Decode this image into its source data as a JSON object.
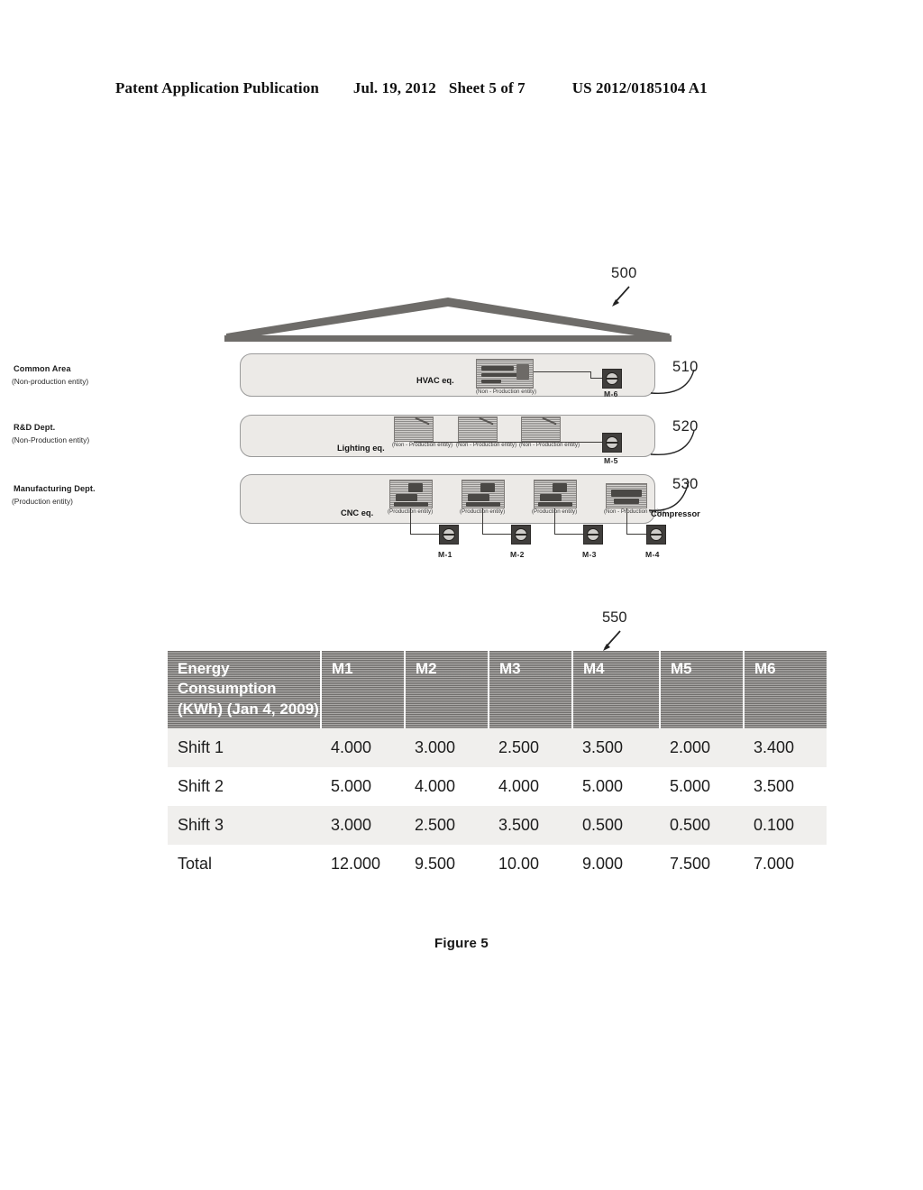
{
  "header": {
    "publication": "Patent Application Publication",
    "date": "Jul. 19, 2012",
    "sheet": "Sheet 5 of 7",
    "patent_number": "US 2012/0185104 A1"
  },
  "figure": {
    "caption": "Figure 5",
    "refs": {
      "building": "500",
      "common_area": "510",
      "rd_dept": "520",
      "manufacturing_dept": "530",
      "table": "550"
    },
    "departments": [
      {
        "title": "Common Area",
        "subtitle": "(Non-production entity)",
        "equipment_label": "HVAC eq.",
        "entity_captions": [
          "(Non - Production entity)"
        ],
        "meter": "M-6"
      },
      {
        "title": "R&D Dept.",
        "subtitle": "(Non-Production entity)",
        "equipment_label": "Lighting eq.",
        "entity_captions": [
          "(Non - Production entity)",
          "(Non - Production entity)",
          "(Non - Production entity)"
        ],
        "meter": "M-5"
      },
      {
        "title": "Manufacturing Dept.",
        "subtitle": "(Production entity)",
        "equipment_label": "CNC eq.",
        "compressor_label": "Compressor",
        "entity_captions": [
          "(Production entity)",
          "(Production entity)",
          "(Production entity)",
          "(Non - Production entity)"
        ],
        "meters": [
          "M-1",
          "M-2",
          "M-3",
          "M-4"
        ]
      }
    ]
  },
  "chart_data": {
    "type": "table",
    "title": "Energy Consumption (KWh) (Jan 4, 2009)",
    "columns": [
      "Energy Consumption (KWh) (Jan 4, 2009)",
      "M1",
      "M2",
      "M3",
      "M4",
      "M5",
      "M6"
    ],
    "rows": [
      {
        "label": "Shift 1",
        "values": [
          "4.000",
          "3.000",
          "2.500",
          "3.500",
          "2.000",
          "3.400"
        ]
      },
      {
        "label": "Shift 2",
        "values": [
          "5.000",
          "4.000",
          "4.000",
          "5.000",
          "5.000",
          "3.500"
        ]
      },
      {
        "label": "Shift 3",
        "values": [
          "3.000",
          "2.500",
          "3.500",
          "0.500",
          "0.500",
          "0.100"
        ]
      },
      {
        "label": "Total",
        "values": [
          "12.000",
          "9.500",
          "10.00",
          "9.000",
          "7.500",
          "7.000"
        ]
      }
    ]
  }
}
